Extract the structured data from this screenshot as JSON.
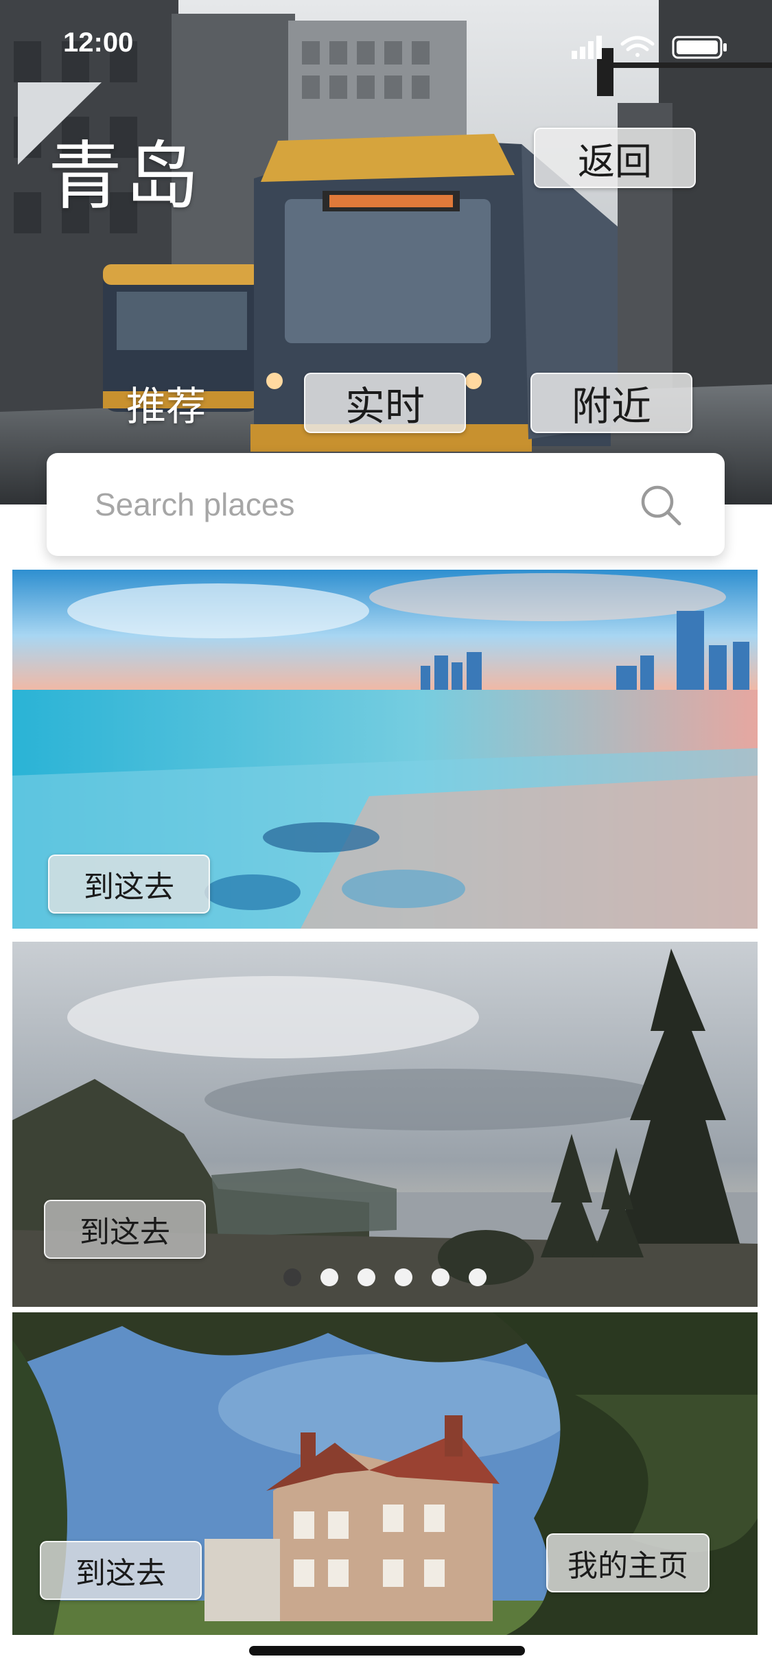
{
  "status_bar": {
    "time": "12:00",
    "icons": [
      "signal-icon",
      "wifi-icon",
      "battery-icon"
    ]
  },
  "header": {
    "city_title": "青岛",
    "back_label": "返回"
  },
  "tabs": [
    {
      "label": "推荐",
      "style": "plain"
    },
    {
      "label": "实时",
      "style": "button"
    },
    {
      "label": "附近",
      "style": "button"
    }
  ],
  "search": {
    "placeholder": "Search places",
    "value": ""
  },
  "cards": [
    {
      "scene": "beach-sunset",
      "go_label": "到这去"
    },
    {
      "scene": "coast-forest",
      "go_label": "到这去"
    },
    {
      "scene": "manor-house",
      "go_label": "到这去",
      "profile_label": "我的主页"
    }
  ],
  "carousel": {
    "count": 6,
    "active_index": 0
  },
  "colors": {
    "background": "#ffffff",
    "button_glass": "#ebebeb",
    "text_dark": "#1b1b1b",
    "dot_active": "#3b3b3b"
  }
}
